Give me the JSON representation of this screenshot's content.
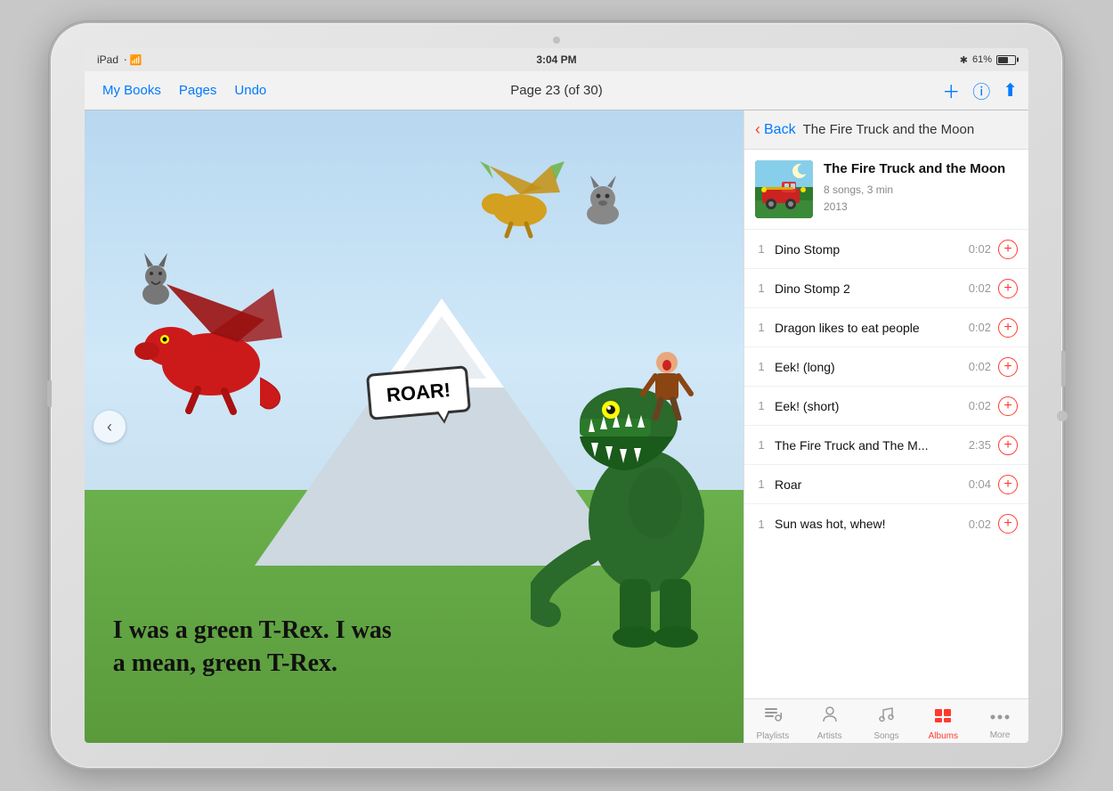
{
  "device": {
    "status_bar": {
      "device_name": "iPad",
      "wifi": "WiFi",
      "time": "3:04 PM",
      "bluetooth": "BT",
      "battery_pct": "61%"
    },
    "toolbar": {
      "my_books_label": "My Books",
      "pages_label": "Pages",
      "undo_label": "Undo",
      "page_indicator": "Page 23 (of 30)"
    }
  },
  "book": {
    "text_line1": "I was a green T-Rex. I was",
    "text_line2": "a mean, green T-Rex.",
    "roar_text": "ROAR!"
  },
  "panel": {
    "back_label": "Back",
    "title": "The Fire Truck and the Moon",
    "album": {
      "name_line1": "The Fire Truck and the",
      "name_line2": "Moon",
      "songs_count": "8 songs, 3 min",
      "year": "2013"
    },
    "songs": [
      {
        "track": "1",
        "title": "Dino Stomp",
        "duration": "0:02"
      },
      {
        "track": "1",
        "title": "Dino Stomp 2",
        "duration": "0:02"
      },
      {
        "track": "1",
        "title": "Dragon likes to eat people",
        "duration": "0:02"
      },
      {
        "track": "1",
        "title": "Eek! (long)",
        "duration": "0:02"
      },
      {
        "track": "1",
        "title": "Eek! (short)",
        "duration": "0:02"
      },
      {
        "track": "1",
        "title": "The Fire Truck and The M...",
        "duration": "2:35"
      },
      {
        "track": "1",
        "title": "Roar",
        "duration": "0:04"
      },
      {
        "track": "1",
        "title": "Sun was hot, whew!",
        "duration": "0:02"
      }
    ],
    "tabs": [
      {
        "id": "playlists",
        "label": "Playlists",
        "icon": "♫",
        "active": false
      },
      {
        "id": "artists",
        "label": "Artists",
        "icon": "♟",
        "active": false
      },
      {
        "id": "songs",
        "label": "Songs",
        "icon": "♪",
        "active": false
      },
      {
        "id": "albums",
        "label": "Albums",
        "icon": "⊞",
        "active": true
      },
      {
        "id": "more",
        "label": "More",
        "icon": "•••",
        "active": false
      }
    ]
  },
  "colors": {
    "accent_blue": "#007aff",
    "accent_red": "#ff3b30",
    "background_gray": "#f2f2f2"
  }
}
